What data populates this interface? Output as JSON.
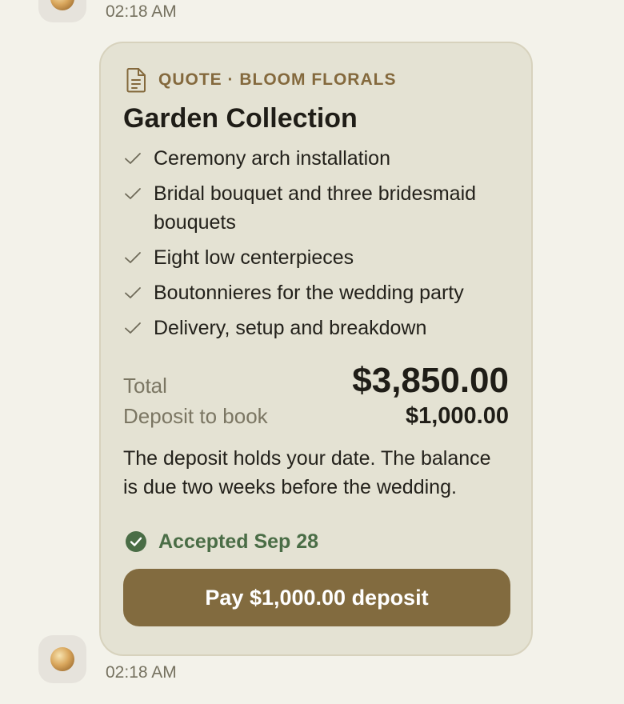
{
  "messages": {
    "top_timestamp": "02:18 AM",
    "bottom_timestamp": "02:18 AM"
  },
  "quote": {
    "label": "QUOTE · BLOOM FLORALS",
    "title": "Garden Collection",
    "items": [
      "Ceremony arch installation",
      "Bridal bouquet and three bridesmaid bouquets",
      "Eight low centerpieces",
      "Boutonnieres for the wedding party",
      "Delivery, setup and breakdown"
    ],
    "total_label": "Total",
    "total_value": "$3,850.00",
    "deposit_label": "Deposit to book",
    "deposit_value": "$1,000.00",
    "note": "The deposit holds your date. The balance is due two weeks before the wedding.",
    "status_text": "Accepted Sep 28",
    "pay_button_label": "Pay $1,000.00 deposit"
  },
  "icons": {
    "document": "document-icon",
    "check": "check-icon",
    "accepted": "check-circle-icon"
  },
  "colors": {
    "accent": "#826b3f",
    "label": "#84693d",
    "success": "#4a6d46",
    "card_background": "#e4e2d3",
    "page_background": "#f3f2ea"
  }
}
